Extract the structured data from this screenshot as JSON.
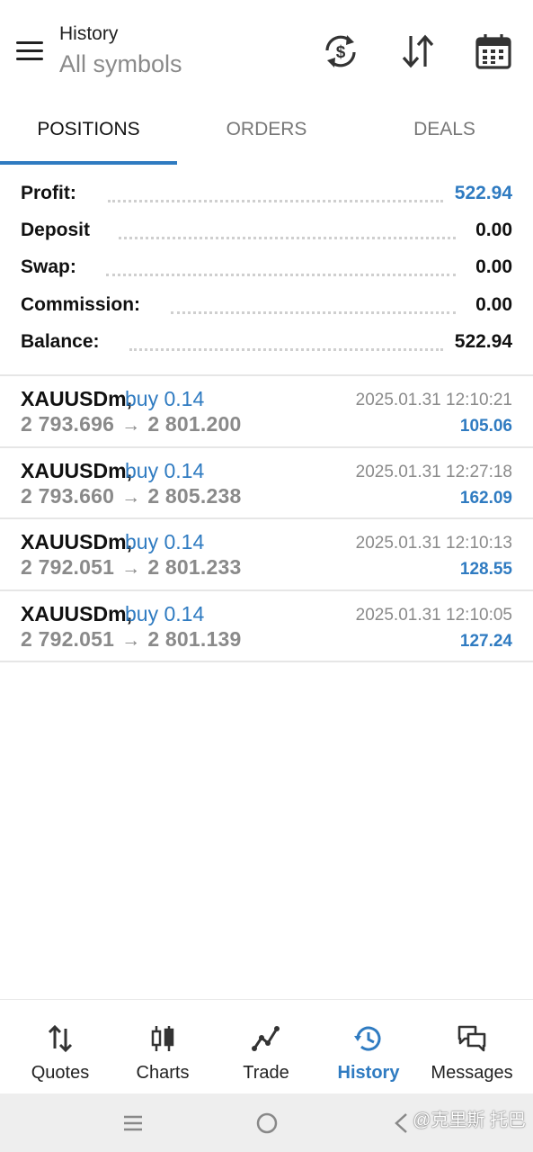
{
  "header": {
    "title": "History",
    "subtitle": "All symbols",
    "icons": [
      "menu-icon",
      "currency-exchange-icon",
      "sort-icon",
      "calendar-icon"
    ]
  },
  "tabs": [
    {
      "label": "POSITIONS",
      "active": true
    },
    {
      "label": "ORDERS",
      "active": false
    },
    {
      "label": "DEALS",
      "active": false
    }
  ],
  "summary": [
    {
      "label": "Profit:",
      "value": "522.94",
      "highlight": true
    },
    {
      "label": "Deposit",
      "value": "0.00",
      "highlight": false
    },
    {
      "label": "Swap:",
      "value": "0.00",
      "highlight": false
    },
    {
      "label": "Commission:",
      "value": "0.00",
      "highlight": false
    },
    {
      "label": "Balance:",
      "value": "522.94",
      "highlight": false
    }
  ],
  "positions": [
    {
      "symbol": "XAUUSDm,",
      "type": "buy 0.14",
      "time": "2025.01.31 12:10:21",
      "open_price": "2 793.696",
      "close_price": "2 801.200",
      "profit": "105.06"
    },
    {
      "symbol": "XAUUSDm,",
      "type": "buy 0.14",
      "time": "2025.01.31 12:27:18",
      "open_price": "2 793.660",
      "close_price": "2 805.238",
      "profit": "162.09"
    },
    {
      "symbol": "XAUUSDm,",
      "type": "buy 0.14",
      "time": "2025.01.31 12:10:13",
      "open_price": "2 792.051",
      "close_price": "2 801.233",
      "profit": "128.55"
    },
    {
      "symbol": "XAUUSDm,",
      "type": "buy 0.14",
      "time": "2025.01.31 12:10:05",
      "open_price": "2 792.051",
      "close_price": "2 801.139",
      "profit": "127.24"
    }
  ],
  "nav": [
    {
      "label": "Quotes",
      "icon": "quotes-arrows-icon",
      "active": false
    },
    {
      "label": "Charts",
      "icon": "candlestick-icon",
      "active": false
    },
    {
      "label": "Trade",
      "icon": "trade-line-icon",
      "active": false
    },
    {
      "label": "History",
      "icon": "history-clock-icon",
      "active": true
    },
    {
      "label": "Messages",
      "icon": "messages-icon",
      "active": false
    }
  ],
  "watermark": "@克里斯 托巴",
  "colors": {
    "accent": "#2f7bc1",
    "text": "#111111",
    "muted": "#8a8a8a",
    "divider": "#e6e6e6"
  }
}
